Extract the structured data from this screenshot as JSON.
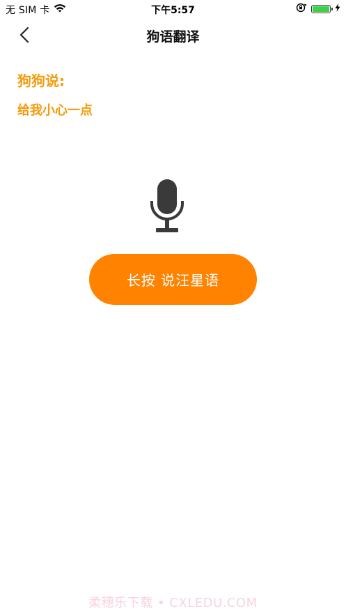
{
  "status_bar": {
    "carrier": "无 SIM 卡",
    "time": "下午5:57",
    "battery_level": 1.0,
    "icons": [
      "wifi-icon",
      "orientation-lock-icon",
      "battery-icon",
      "charging-bolt-icon"
    ]
  },
  "nav": {
    "title": "狗语翻译",
    "back_icon": "chevron-left-icon"
  },
  "content": {
    "dog_says_label": "狗狗说:",
    "dog_says_text": "给我小心一点",
    "mic_icon": "microphone-icon",
    "record_button_label": "长按 说汪星语"
  },
  "watermark": "柔穗乐下载 • CXLEDU.COM",
  "colors": {
    "accent_text": "#f59a0b",
    "button": "#ff8200",
    "button_text": "#ffffff",
    "watermark": "#f6d4e0"
  }
}
